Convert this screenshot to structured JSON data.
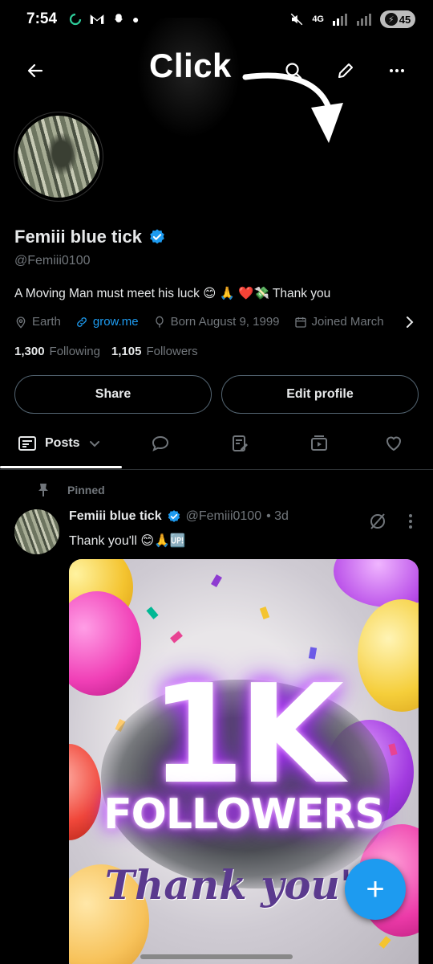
{
  "status_bar": {
    "time": "7:54",
    "network": "4G",
    "battery": "45"
  },
  "overlay": {
    "click_text": "Click"
  },
  "profile": {
    "name": "Femiii blue tick",
    "handle": "@Femiii0100",
    "bio": "A Moving Man must meet his luck 😊 🙏 ❤️💸 Thank  you",
    "location": "Earth",
    "website": "grow.me",
    "birthday": "Born August 9, 1999",
    "joined": "Joined March",
    "following_count": "1,300",
    "following_label": "Following",
    "followers_count": "1,105",
    "followers_label": "Followers"
  },
  "buttons": {
    "share": "Share",
    "edit_profile": "Edit profile"
  },
  "tabs": {
    "posts_label": "Posts"
  },
  "post": {
    "pinned_label": "Pinned",
    "author": "Femiii blue tick",
    "handle": "@Femiii0100",
    "time": "• 3d",
    "text": "Thank you'll 😊🙏🆙",
    "media_big": "1K",
    "media_followers": "FOLLOWERS",
    "media_thanks": "Thank you'll"
  },
  "fab_label": "+",
  "colors": {
    "accent": "#1d9bf0",
    "background": "#000000",
    "secondary_text": "#71767b"
  }
}
